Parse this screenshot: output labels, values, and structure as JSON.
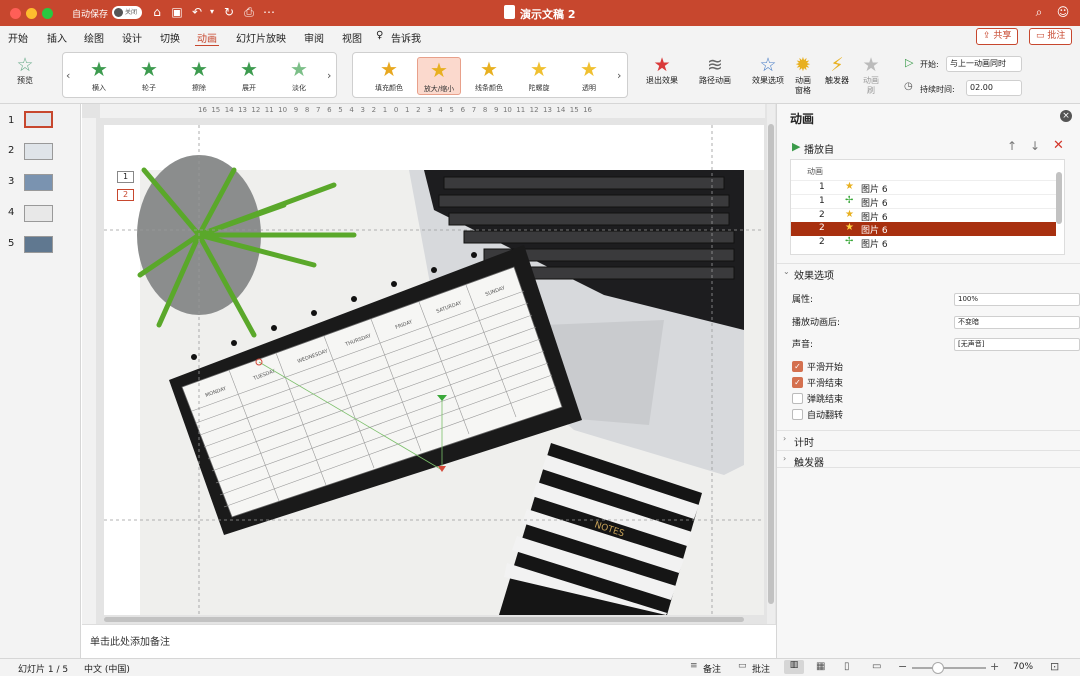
{
  "titlebar": {
    "autosave_label": "自动保存",
    "toggle_label": "关闭",
    "doc_title": "演示文稿 2"
  },
  "tabs": [
    "开始",
    "插入",
    "绘图",
    "设计",
    "切换",
    "动画",
    "幻灯片放映",
    "审阅",
    "视图",
    "告诉我"
  ],
  "header_buttons": {
    "share": "共享",
    "comments": "批注"
  },
  "ribbon": {
    "preview": "预览",
    "gallery1": [
      "横入",
      "轮子",
      "擦除",
      "展开",
      "淡化"
    ],
    "gallery2": [
      "填充颜色",
      "放大/缩小",
      "线条颜色",
      "陀螺旋",
      "透明"
    ],
    "exit_effect": "退出效果",
    "path_anim": "路径动画",
    "effect_options": "效果选项",
    "anim_pane": "动画\n窗格",
    "trigger": "触发器",
    "anim_brush": "动画\n刷",
    "start_label": "开始:",
    "start_value": "与上一动画同时",
    "duration_label": "持续时间:",
    "duration_value": "02.00"
  },
  "slides": [
    {
      "num": "1"
    },
    {
      "num": "2"
    },
    {
      "num": "3"
    },
    {
      "num": "4"
    },
    {
      "num": "5"
    }
  ],
  "slide_tags": [
    "1",
    "2"
  ],
  "calendar_days": [
    "MONDAY",
    "TUESDAY",
    "WEDNESDAY",
    "THURSDAY",
    "FRIDAY",
    "SATURDAY",
    "SUNDAY"
  ],
  "notebook_text": "NOTES",
  "notes_placeholder": "单击此处添加备注",
  "ruler_top": "16  15  14  13  12  11  10   9   8   7   6   5   4   3   2   1   0   1   2   3   4   5   6   7   8   9  10  11  12  13  14  15  16",
  "pane": {
    "title": "动画",
    "play_from": "播放自",
    "list_header": "动画",
    "items": [
      {
        "num": "1",
        "name": "图片 6"
      },
      {
        "num": "1",
        "name": "图片 6"
      },
      {
        "num": "2",
        "name": "图片 6"
      },
      {
        "num": "2",
        "name": "图片 6"
      },
      {
        "num": "2",
        "name": "图片 6"
      }
    ],
    "effect_options": "效果选项",
    "property_label": "属性:",
    "property_value": "100%",
    "after_label": "播放动画后:",
    "after_value": "不变暗",
    "sound_label": "声音:",
    "sound_value": "[无声音]",
    "checks": [
      {
        "label": "平滑开始",
        "on": true
      },
      {
        "label": "平滑结束",
        "on": true
      },
      {
        "label": "弹跳结束",
        "on": false
      },
      {
        "label": "自动翻转",
        "on": false
      }
    ],
    "timing": "计时",
    "triggers": "触发器"
  },
  "status": {
    "slide_count": "幻灯片 1 / 5",
    "language": "中文 (中国)",
    "notes": "备注",
    "comments": "批注",
    "zoom": "70%"
  },
  "colors": {
    "accent": "#c7472e",
    "selected_row": "#a8300f"
  }
}
